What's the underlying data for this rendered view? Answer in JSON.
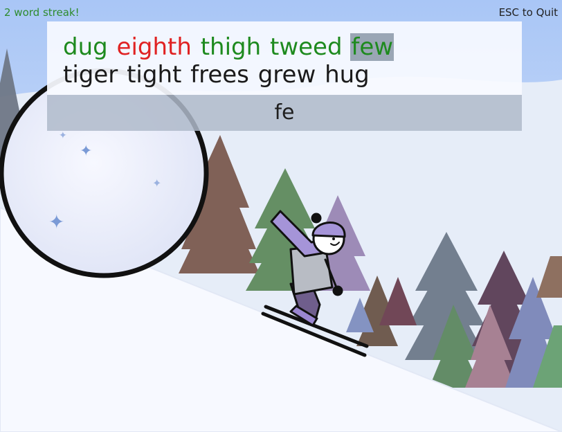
{
  "hud": {
    "streak_text": "2 word streak!",
    "quit_text": "ESC to Quit",
    "streak_color": "#2e8b2e",
    "quit_color": "#222222"
  },
  "words": {
    "line1": [
      {
        "text": "dug",
        "status": "correct"
      },
      {
        "text": "eighth",
        "status": "wrong"
      },
      {
        "text": "thigh",
        "status": "correct"
      },
      {
        "text": "tweed",
        "status": "correct"
      },
      {
        "text": "few",
        "status": "current"
      }
    ],
    "line2": [
      {
        "text": "tiger",
        "status": "pending"
      },
      {
        "text": "tight",
        "status": "pending"
      },
      {
        "text": "frees",
        "status": "pending"
      },
      {
        "text": "grew",
        "status": "pending"
      },
      {
        "text": "hug",
        "status": "pending"
      }
    ]
  },
  "input": {
    "typed": "fe"
  },
  "colors": {
    "correct": "#1e8a1e",
    "wrong": "#e02222",
    "current": "#1e8a1e",
    "pending": "#1a1a1a",
    "sky": "#b9cff5",
    "snow": "#f7f9ff"
  },
  "scene": {
    "snowball": "snowball",
    "skier": "skier",
    "trees": "pine-trees"
  }
}
